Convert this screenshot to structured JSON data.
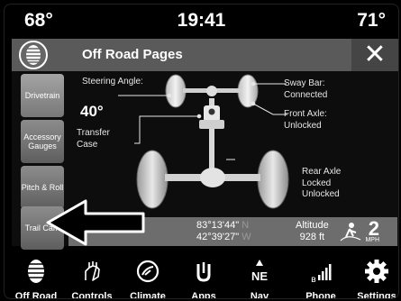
{
  "status": {
    "temp_left": "68°",
    "time": "19:41",
    "temp_right": "71°"
  },
  "header": {
    "title": "Off Road Pages",
    "close_label": "✕",
    "icon": "off-road-tire-icon"
  },
  "sidebar": {
    "items": [
      {
        "label": "Drivetrain"
      },
      {
        "label": "Accessory Gauges"
      },
      {
        "label": "Pitch & Roll"
      },
      {
        "label": "Trail Cam"
      }
    ]
  },
  "diagram": {
    "steering_label": "Steering Angle:",
    "steering_value": "40°",
    "transfer_label": "Transfer Case",
    "sway_label": "Sway Bar: Connected",
    "front_axle_label": "Front Axle: Unlocked",
    "rear_axle_label": "Rear Axle Locked Unlocked"
  },
  "info": {
    "lat": "83°13'44\"",
    "lat_dir": "N",
    "lon": "42°39'27\"",
    "lon_dir": "W",
    "altitude_label": "Altitude",
    "altitude_value": "928 ft",
    "speed_value": "2",
    "speed_unit": "MPH"
  },
  "nav": {
    "items": [
      {
        "label": "Off Road",
        "icon": "off-road-tire-icon"
      },
      {
        "label": "Controls",
        "icon": "controls-hand-icon"
      },
      {
        "label": "Climate",
        "icon": "climate-icon"
      },
      {
        "label": "Apps",
        "icon": "apps-icon"
      },
      {
        "label": "Nav",
        "icon": "compass-icon",
        "icon_text": "NE"
      },
      {
        "label": "Phone",
        "icon": "phone-signal-icon"
      },
      {
        "label": "Settings",
        "icon": "gear-icon"
      }
    ]
  },
  "colors": {
    "titlebar": "#5a5a5a",
    "infobar": "#6d6d6d",
    "sidebar_button": "#7a7a7a"
  }
}
